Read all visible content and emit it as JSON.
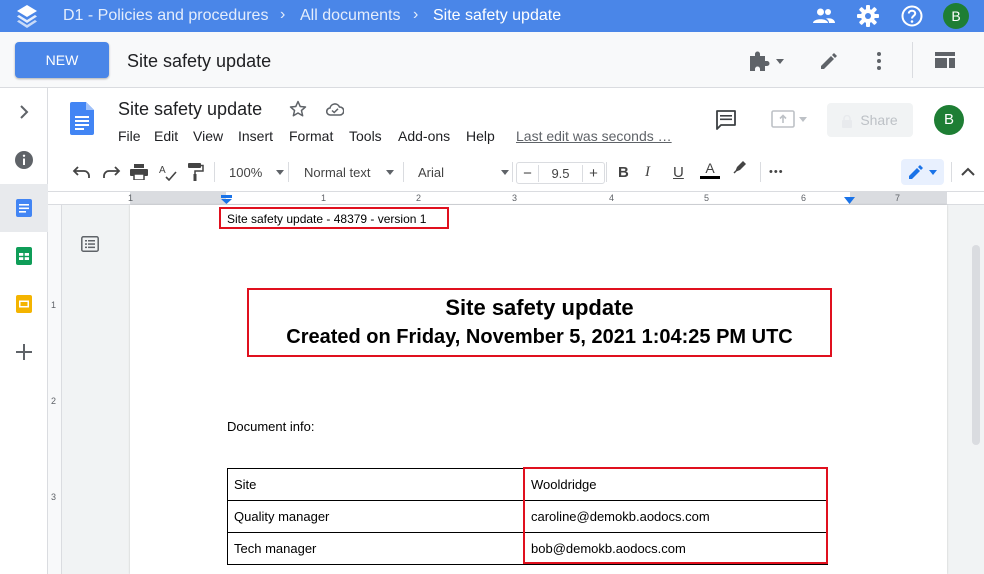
{
  "appbar": {
    "breadcrumbs": [
      "D1 - Policies and procedures",
      "All documents",
      "Site safety update"
    ],
    "avatar": "B"
  },
  "secbar": {
    "new_label": "NEW",
    "title": "Site safety update"
  },
  "docs": {
    "title": "Site safety update",
    "menus": [
      "File",
      "Edit",
      "View",
      "Insert",
      "Format",
      "Tools",
      "Add-ons",
      "Help"
    ],
    "last_edit": "Last edit was seconds …",
    "share": "Share",
    "avatar": "B"
  },
  "toolbar": {
    "zoom": "100%",
    "style": "Normal text",
    "font": "Arial",
    "font_size": "9.5",
    "bold": "B",
    "italic": "I",
    "underline": "U",
    "text_color": "A",
    "more": "•••"
  },
  "ruler": {
    "numbers": [
      "1",
      "1",
      "2",
      "3",
      "4",
      "5",
      "6",
      "7"
    ],
    "vnumbers": [
      "1",
      "2",
      "3"
    ]
  },
  "document": {
    "header_line": "Site safety update - 48379 - version 1",
    "heading_title": "Site safety update",
    "heading_created": "Created on Friday, November 5, 2021 1:04:25 PM UTC",
    "info_label": "Document info:",
    "rows": [
      {
        "label": "Site",
        "value": "Wooldridge"
      },
      {
        "label": "Quality manager",
        "value": "caroline@demokb.aodocs.com"
      },
      {
        "label": "Tech manager",
        "value": "bob@demokb.aodocs.com"
      }
    ]
  },
  "colors": {
    "appbar": "#4a86e8",
    "highlight_border": "#e0101e",
    "avatar": "#1e7e34"
  }
}
